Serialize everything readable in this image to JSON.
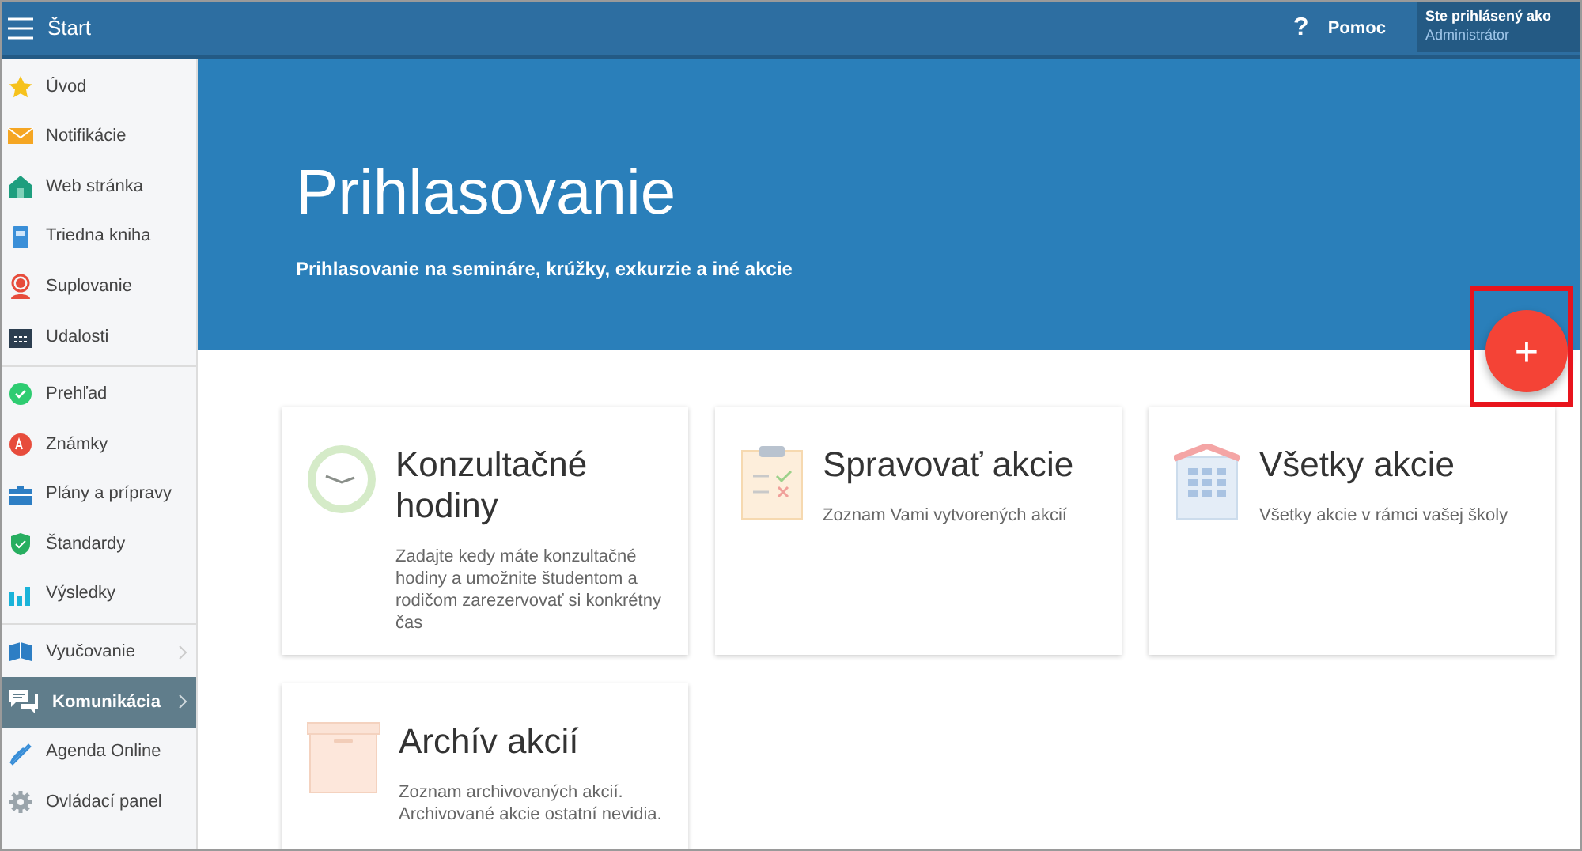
{
  "header": {
    "title": "Štart",
    "help": {
      "icon": "?",
      "label": "Pomoc"
    },
    "user": {
      "caption": "Ste prihlásený ako",
      "name": "Administrátor"
    }
  },
  "sidebar": {
    "groups": [
      [
        {
          "label": "Úvod",
          "selected": false,
          "expandable": false
        },
        {
          "label": "Notifikácie",
          "selected": false,
          "expandable": false
        },
        {
          "label": "Web stránka",
          "selected": false,
          "expandable": false
        },
        {
          "label": "Triedna kniha",
          "selected": false,
          "expandable": false
        },
        {
          "label": "Suplovanie",
          "selected": false,
          "expandable": false
        },
        {
          "label": "Udalosti",
          "selected": false,
          "expandable": false
        }
      ],
      [
        {
          "label": "Prehľad",
          "selected": false,
          "expandable": false
        },
        {
          "label": "Známky",
          "selected": false,
          "expandable": false
        },
        {
          "label": "Plány a prípravy",
          "selected": false,
          "expandable": false
        },
        {
          "label": "Štandardy",
          "selected": false,
          "expandable": false
        },
        {
          "label": "Výsledky",
          "selected": false,
          "expandable": false
        }
      ],
      [
        {
          "label": "Vyučovanie",
          "selected": false,
          "expandable": true
        },
        {
          "label": "Komunikácia",
          "selected": true,
          "expandable": true
        },
        {
          "label": "Agenda Online",
          "selected": false,
          "expandable": false
        },
        {
          "label": "Ovládací panel",
          "selected": false,
          "expandable": false
        }
      ]
    ]
  },
  "hero": {
    "title": "Prihlasovanie",
    "subtitle": "Prihlasovanie na semináre, krúžky, exkurzie a iné akcie"
  },
  "add_button": {
    "label": "+",
    "highlighted": true
  },
  "cards": [
    {
      "kind": "clock",
      "title": "Konzultačné hodiny",
      "description": "Zadajte kedy máte konzultačné hodiny a umožnite študentom a rodičom zarezervovať si konkrétny čas"
    },
    {
      "kind": "clipboard",
      "title": "Spravovať akcie",
      "description": "Zoznam Vami vytvorených akcií"
    },
    {
      "kind": "building",
      "title": "Všetky akcie",
      "description": "Všetky akcie v rámci vašej školy"
    },
    {
      "kind": "box",
      "title": "Archív akcií",
      "description": "Zoznam archivovaných akcií. Archivované akcie ostatní nevidia."
    }
  ]
}
